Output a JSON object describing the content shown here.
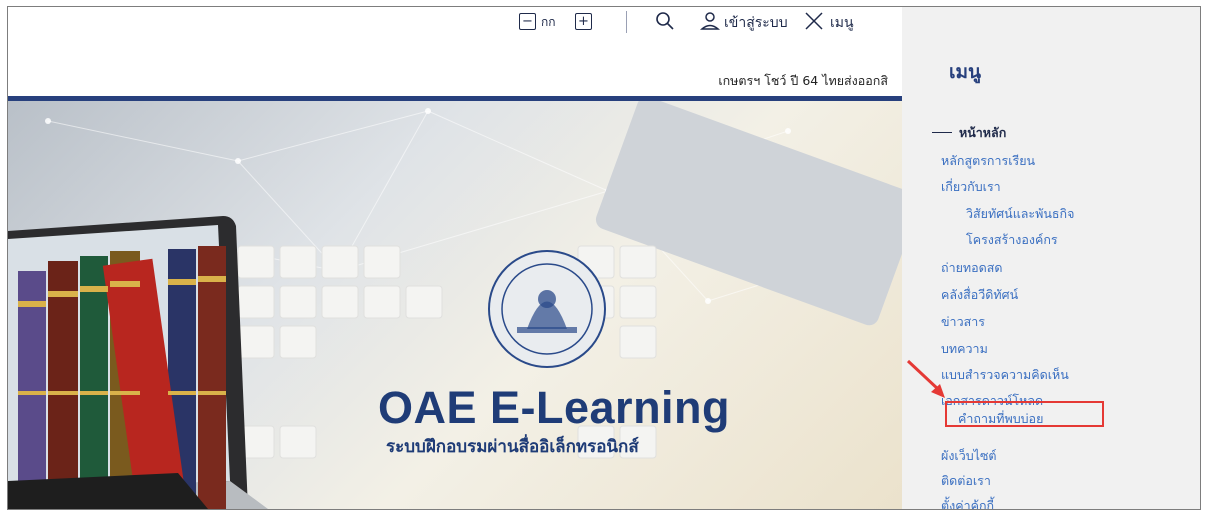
{
  "topbar": {
    "font_decrease": "−",
    "font_label": "กก",
    "font_increase": "+",
    "search_icon": "search-icon",
    "login_label": "เข้าสู่ระบบ",
    "menu_label": "เมนู"
  },
  "ticker": "เกษตรฯ โชว์ ปี 64 ไทยส่งออกสิ",
  "banner": {
    "title": "OAE E-Learning",
    "subtitle": "ระบบฝึกอบรมผ่านสื่ออิเล็กทรอนิกส์"
  },
  "sidebar": {
    "title": "เมนู",
    "items": [
      {
        "label": "หน้าหลัก"
      },
      {
        "label": "หลักสูตรการเรียน"
      },
      {
        "label": "เกี่ยวกับเรา"
      },
      {
        "label": "วิสัยทัศน์และพันธกิจ"
      },
      {
        "label": "โครงสร้างองค์กร"
      },
      {
        "label": "ถ่ายทอดสด"
      },
      {
        "label": "คลังสื่อวีดิทัศน์"
      },
      {
        "label": "ข่าวสาร"
      },
      {
        "label": "บทความ"
      },
      {
        "label": "แบบสำรวจความคิดเห็น"
      },
      {
        "label": "เอกสารดาวน์โหลด"
      },
      {
        "label": "คำถามที่พบบ่อย"
      },
      {
        "label": "ผังเว็บไซต์"
      },
      {
        "label": "ติดต่อเรา"
      },
      {
        "label": "ตั้งค่าคุ้กกี้"
      }
    ]
  },
  "colors": {
    "accent": "#27407d",
    "link": "#3a6fc1",
    "highlight": "#e53935"
  }
}
